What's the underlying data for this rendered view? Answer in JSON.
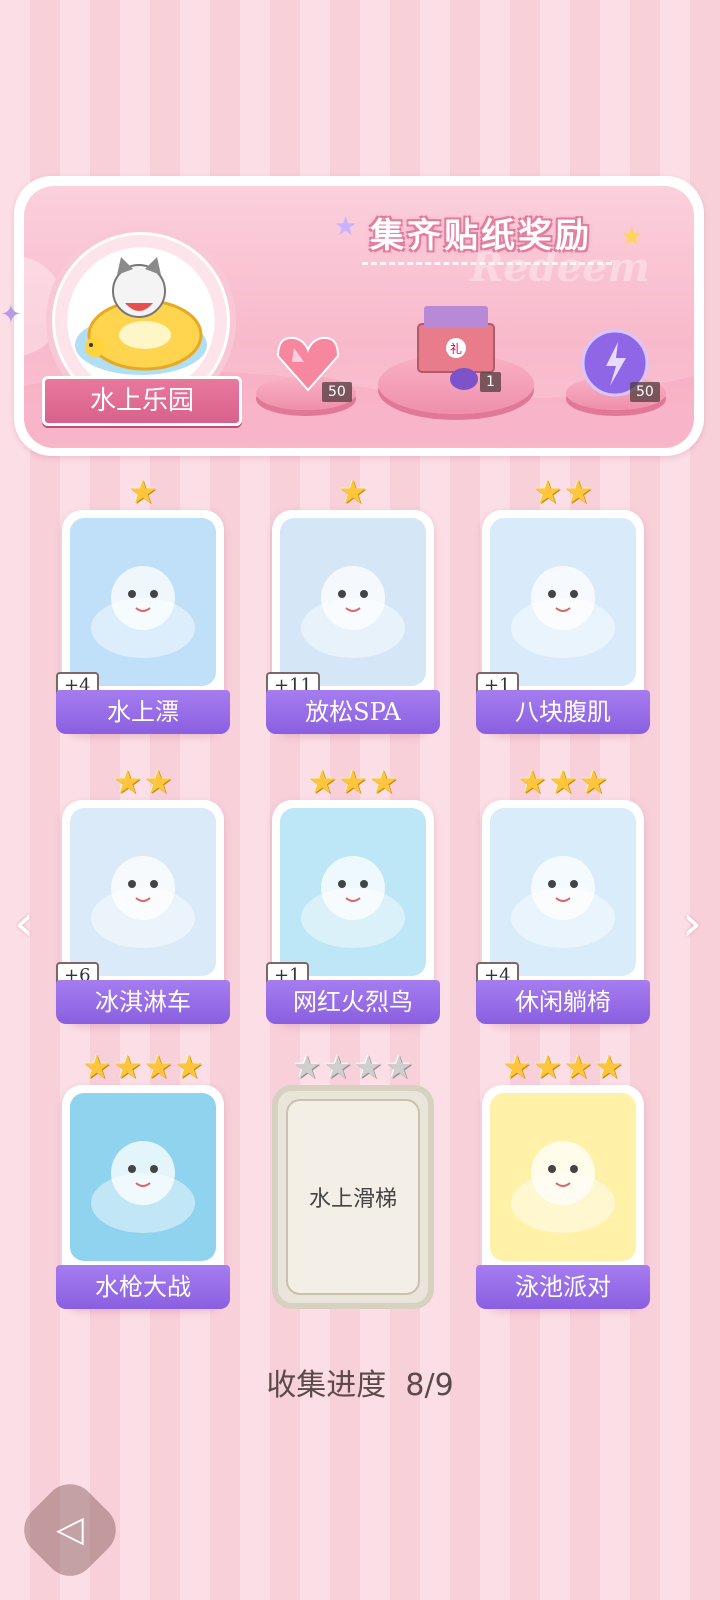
{
  "banner": {
    "title": "集齐贴纸奖励",
    "watermark": "Redeem",
    "theme_name": "水上乐园",
    "rewards": [
      {
        "icon": "pink-heart-diamond-icon",
        "count": "50"
      },
      {
        "icon": "gift-box-icon",
        "count": "1"
      },
      {
        "icon": "purple-energy-orb-icon",
        "count": "50"
      }
    ]
  },
  "cards": [
    {
      "name": "水上漂",
      "stars": 1,
      "badge": "+4",
      "icon": "cat-on-float-icon"
    },
    {
      "name": "放松SPA",
      "stars": 1,
      "badge": "+11",
      "icon": "spa-candle-icon"
    },
    {
      "name": "八块腹肌",
      "stars": 2,
      "badge": "+1",
      "icon": "muscle-cat-icon"
    },
    {
      "name": "冰淇淋车",
      "stars": 2,
      "badge": "+6",
      "icon": "ice-cream-truck-icon"
    },
    {
      "name": "网红火烈鸟",
      "stars": 3,
      "badge": "+1",
      "icon": "flamingo-cat-icon"
    },
    {
      "name": "休闲躺椅",
      "stars": 3,
      "badge": "+4",
      "icon": "beach-chair-icon"
    },
    {
      "name": "水枪大战",
      "stars": 4,
      "badge": "",
      "icon": "water-gun-boy-icon"
    },
    {
      "name": "水上滑梯",
      "stars": 4,
      "badge": "",
      "icon": "locked-card-icon",
      "locked": true
    },
    {
      "name": "泳池派对",
      "stars": 4,
      "badge": "",
      "icon": "bunny-pool-party-icon"
    }
  ],
  "progress": {
    "label": "收集进度",
    "value": "8/9"
  },
  "colors": {
    "accent_purple": "#8a5fe0",
    "pink_bg": "#fcdfe6",
    "star_gold": "#ffc53d"
  }
}
